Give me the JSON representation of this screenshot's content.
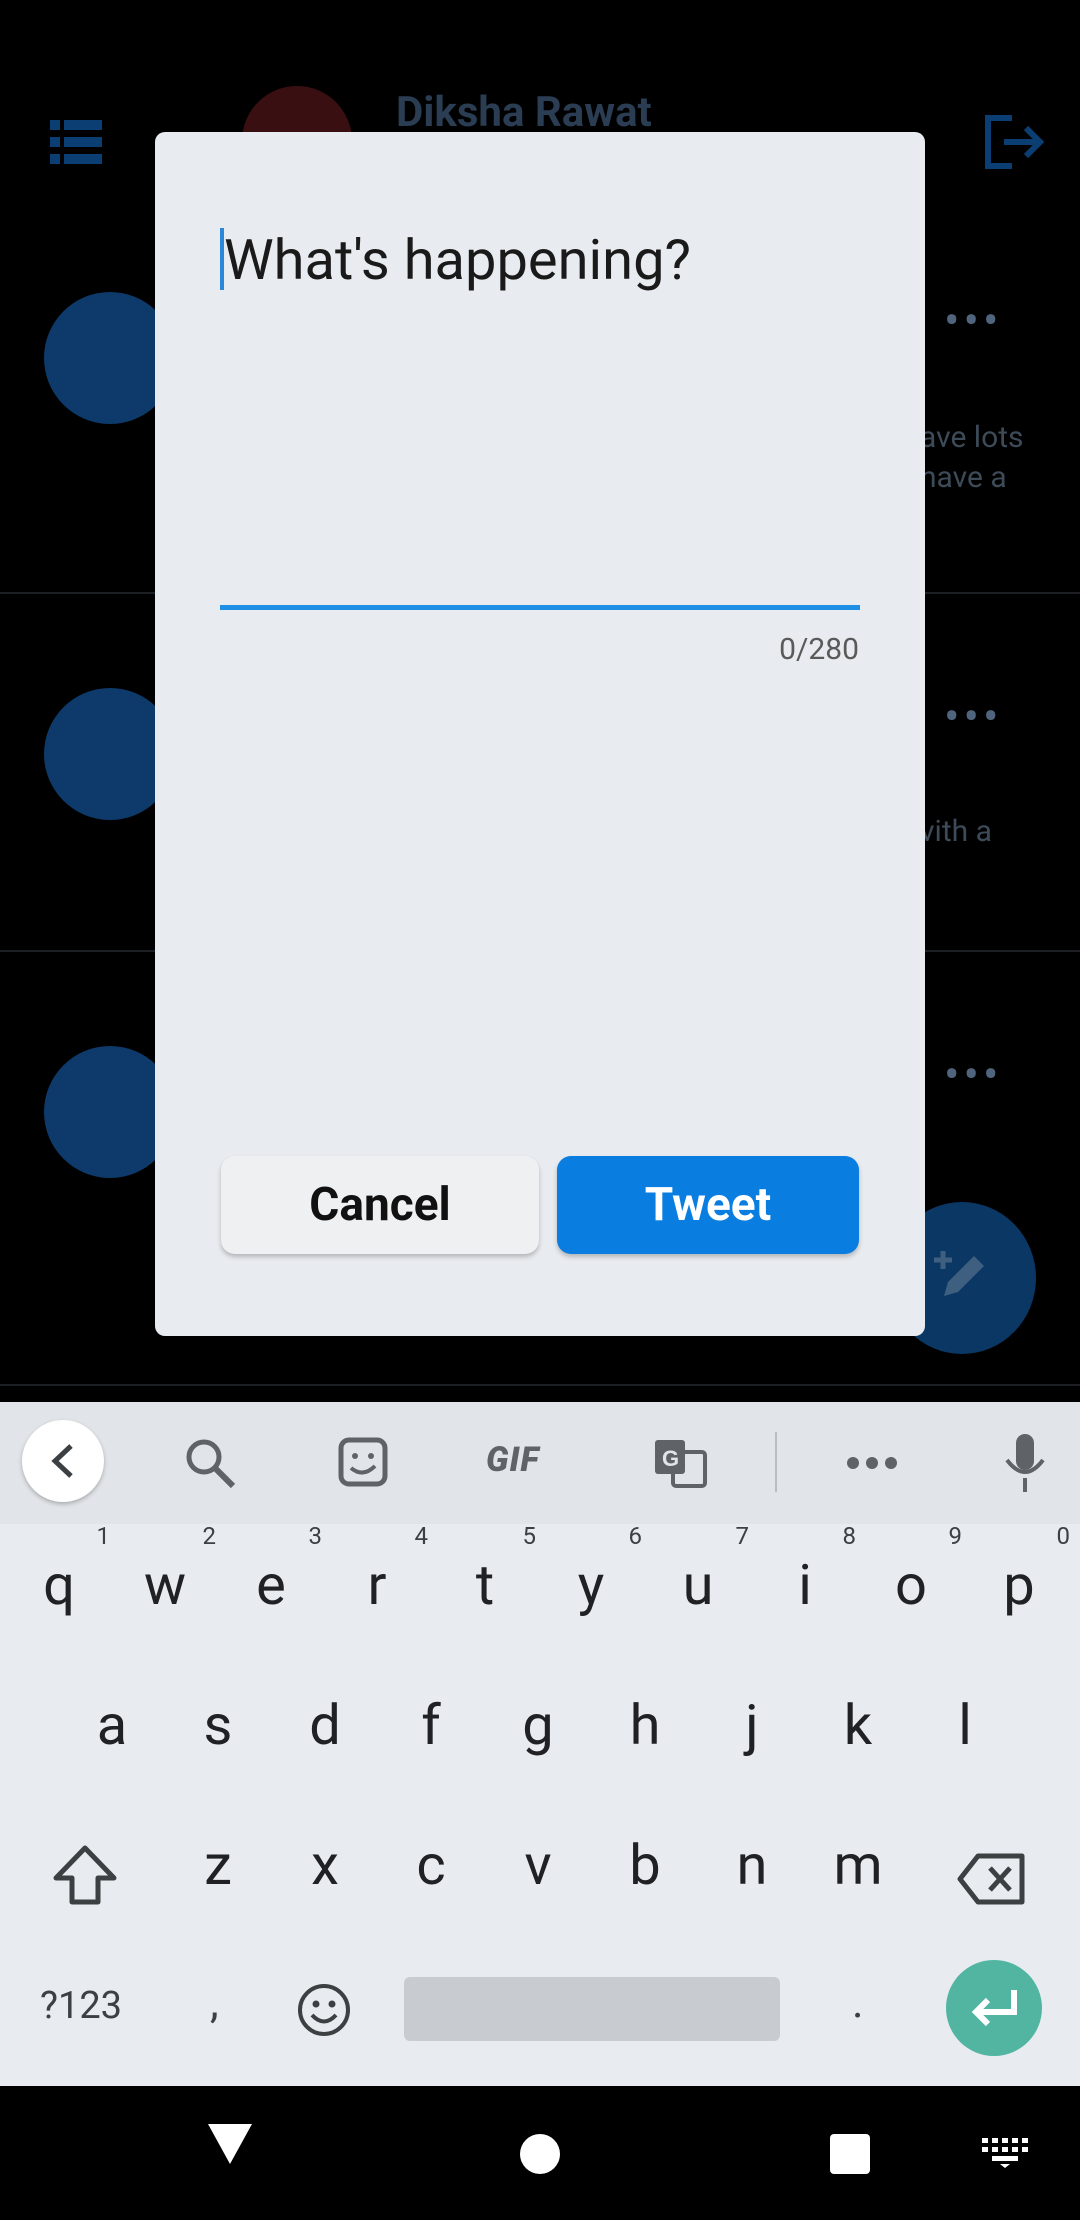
{
  "background_app": {
    "username": "Diksha Rawat",
    "post1_text_line1": "ave lots",
    "post1_text_line2": "have a",
    "post2_text_line1": "vith a",
    "more_glyph": "•••"
  },
  "compose_dialog": {
    "placeholder": "What's happening?",
    "value": "",
    "char_counter": "0/280",
    "cancel_label": "Cancel",
    "tweet_label": "Tweet"
  },
  "keyboard": {
    "toolbar": {
      "gif_label": "GIF",
      "icons": [
        "back-icon",
        "search-icon",
        "sticker-icon",
        "gif-icon",
        "translate-icon",
        "more-icon",
        "mic-icon"
      ]
    },
    "row1": [
      {
        "key": "q",
        "sup": "1"
      },
      {
        "key": "w",
        "sup": "2"
      },
      {
        "key": "e",
        "sup": "3"
      },
      {
        "key": "r",
        "sup": "4"
      },
      {
        "key": "t",
        "sup": "5"
      },
      {
        "key": "y",
        "sup": "6"
      },
      {
        "key": "u",
        "sup": "7"
      },
      {
        "key": "i",
        "sup": "8"
      },
      {
        "key": "o",
        "sup": "9"
      },
      {
        "key": "p",
        "sup": "0"
      }
    ],
    "row2": [
      "a",
      "s",
      "d",
      "f",
      "g",
      "h",
      "j",
      "k",
      "l"
    ],
    "row3": [
      "z",
      "x",
      "c",
      "v",
      "b",
      "n",
      "m"
    ],
    "symbols_label": "?123",
    "comma_label": ",",
    "period_label": "."
  },
  "colors": {
    "accent_blue": "#0a7ee0",
    "underline_blue": "#1f8fe5",
    "enter_key": "#52b5a2",
    "dialog_bg": "#e8ebef"
  }
}
